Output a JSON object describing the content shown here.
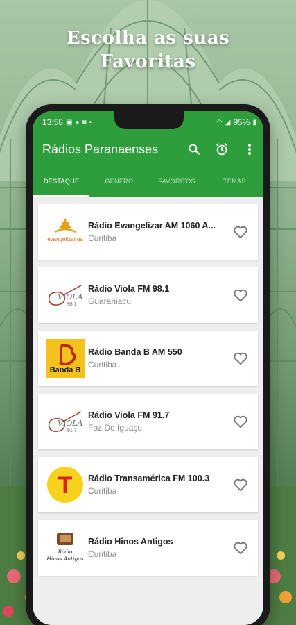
{
  "promo": {
    "headline_line1": "Escolha as suas",
    "headline_line2": "Favoritas"
  },
  "status_bar": {
    "time": "13:58",
    "battery": "95%"
  },
  "app_bar": {
    "title": "Rádios Paranaenses"
  },
  "tabs": [
    {
      "label": "DESTAQUE",
      "active": true
    },
    {
      "label": "GÊNERO",
      "active": false
    },
    {
      "label": "FAVORITOS",
      "active": false
    },
    {
      "label": "TEMAS",
      "active": false
    }
  ],
  "stations": [
    {
      "name": "Rádio Evangelizar AM 1060 A...",
      "city": "Curitiba",
      "logo": "evangelizar-logo"
    },
    {
      "name": "Rádio Viola FM 98.1",
      "city": "Guaraniacu",
      "logo": "viola-logo"
    },
    {
      "name": "Rádio Banda B AM 550",
      "city": "Curitiba",
      "logo": "banda-b-logo"
    },
    {
      "name": "Rádio Viola FM 91.7",
      "city": "Foz Do Iguaçu",
      "logo": "viola-logo"
    },
    {
      "name": "Rádio Transamérica FM 100.3",
      "city": "Curitiba",
      "logo": "transamerica-logo"
    },
    {
      "name": "Rádio Hinos Antigos",
      "city": "Curitiba",
      "logo": "hinos-antigos-logo"
    }
  ],
  "logos": {
    "evangelizar_text": "evangelizar.ua",
    "viola1_text": "VIOLA",
    "viola1_freq": "98.1",
    "viola2_text": "VIOLA",
    "viola2_freq": "91.7",
    "bandab_text": "Banda B",
    "transamerica_letter": "T",
    "hinos_line1": "Rádio",
    "hinos_line2": "Hinos Antigos"
  },
  "colors": {
    "primary": "#2e9d3c",
    "background": "#eeeeee",
    "card": "#ffffff"
  }
}
